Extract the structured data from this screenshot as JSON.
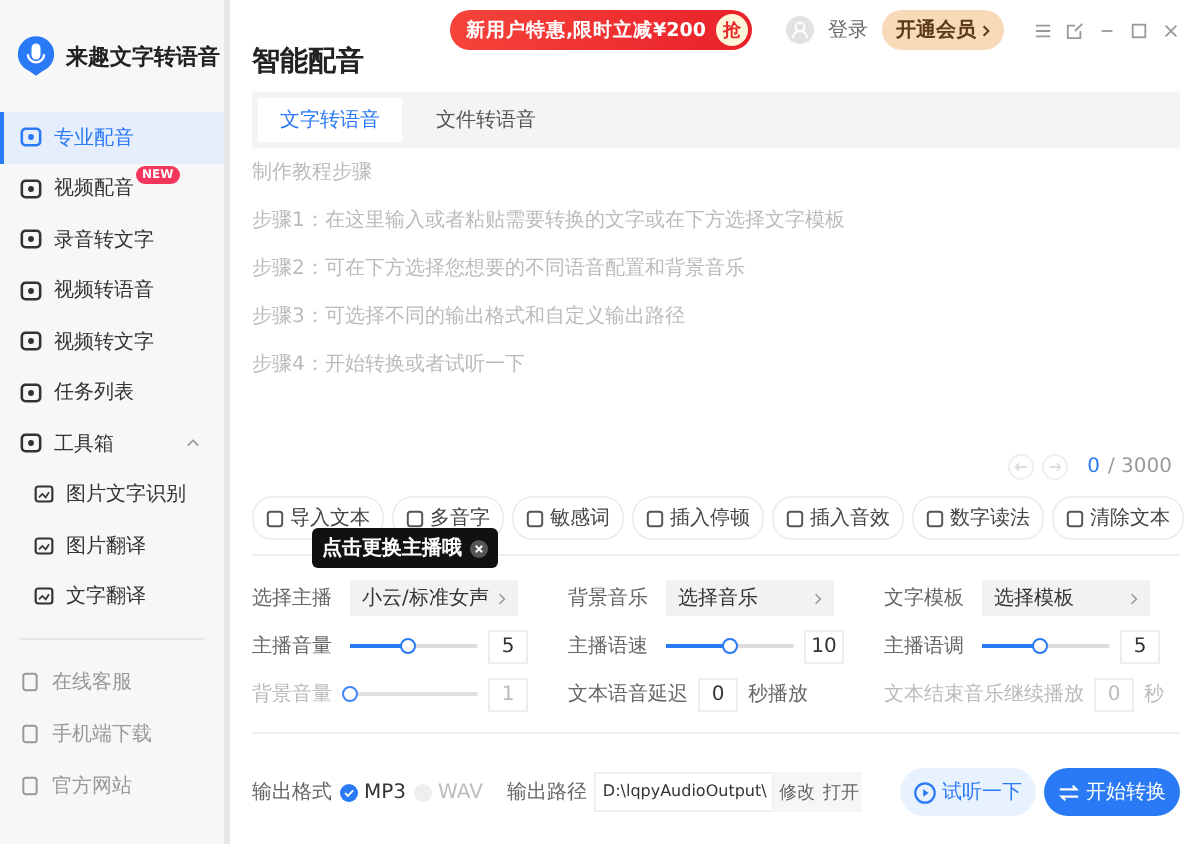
{
  "app": {
    "name": "来趣文字转语音"
  },
  "sidebar": {
    "items": [
      {
        "label": "专业配音",
        "selected": true
      },
      {
        "label": "视频配音",
        "selected": false,
        "badge": "NEW"
      },
      {
        "label": "录音转文字",
        "selected": false
      },
      {
        "label": "视频转语音",
        "selected": false
      },
      {
        "label": "视频转文字",
        "selected": false
      },
      {
        "label": "任务列表",
        "selected": false
      },
      {
        "label": "工具箱",
        "selected": false,
        "expanded": true,
        "children": [
          {
            "label": "图片文字识别",
            "selected": false
          },
          {
            "label": "图片翻译",
            "selected": false
          },
          {
            "label": "文字翻译",
            "selected": false
          }
        ]
      }
    ],
    "footer_links": [
      {
        "label": "在线客服"
      },
      {
        "label": "手机端下载"
      },
      {
        "label": "官方网站"
      }
    ]
  },
  "header": {
    "promo": "新用户特惠,限时立减¥200",
    "promo_button": "抢",
    "login": "登录",
    "vip": "开通会员"
  },
  "page_title": "智能配音",
  "tabs": [
    {
      "label": "文字转语音",
      "selected": true
    },
    {
      "label": "文件转语音",
      "selected": false
    }
  ],
  "editor": {
    "tutorial_title": "制作教程步骤",
    "tutorial_steps": [
      "步骤1：在这里输入或者粘贴需要转换的文字或在下方选择文字模板",
      "步骤2：可在下方选择您想要的不同语音配置和背景音乐",
      "步骤3：可选择不同的输出格式和自定义输出路径",
      "步骤4：开始转换或者试听一下"
    ],
    "count": "0",
    "limit": "/ 3000"
  },
  "toolbar": [
    {
      "label": "导入文本"
    },
    {
      "label": "多音字"
    },
    {
      "label": "敏感词"
    },
    {
      "label": "插入停顿"
    },
    {
      "label": "插入音效"
    },
    {
      "label": "数字读法"
    },
    {
      "label": "清除文本"
    }
  ],
  "tooltip": {
    "text": "点击更换主播哦"
  },
  "settings": [
    {
      "label": "选择主播",
      "kind": "select",
      "value": "小云/标准女声",
      "disabled": false
    },
    {
      "label": "背景音乐",
      "kind": "select",
      "value": "选择音乐",
      "disabled": false
    },
    {
      "label": "文字模板",
      "kind": "select",
      "value": "选择模板",
      "disabled": false
    },
    {
      "label": "主播音量",
      "kind": "slider",
      "level": 0.45,
      "value": "5",
      "disabled": false
    },
    {
      "label": "主播语速",
      "kind": "slider",
      "level": 0.5,
      "value": "10",
      "disabled": false
    },
    {
      "label": "主播语调",
      "kind": "slider",
      "level": 0.45,
      "value": "5",
      "disabled": false
    },
    {
      "label": "背景音量",
      "kind": "slider",
      "level": 0,
      "value": "1",
      "disabled": true
    },
    {
      "label": "文本语音延迟",
      "kind": "delay",
      "value": "0",
      "unit": "秒播放",
      "disabled": false
    },
    {
      "label": "文本结束音乐继续播放",
      "kind": "delay",
      "value": "0",
      "unit": "秒",
      "disabled": true
    }
  ],
  "output": {
    "format_label": "输出格式",
    "formats": [
      {
        "label": "MP3",
        "selected": true
      },
      {
        "label": "WAV",
        "selected": false
      }
    ],
    "path_label": "输出路径",
    "path": "D:\\lqpyAudioOutput\\",
    "path_buttons": [
      "修改",
      "打开"
    ]
  },
  "actions": {
    "preview": "试听一下",
    "start": "开始转换"
  }
}
